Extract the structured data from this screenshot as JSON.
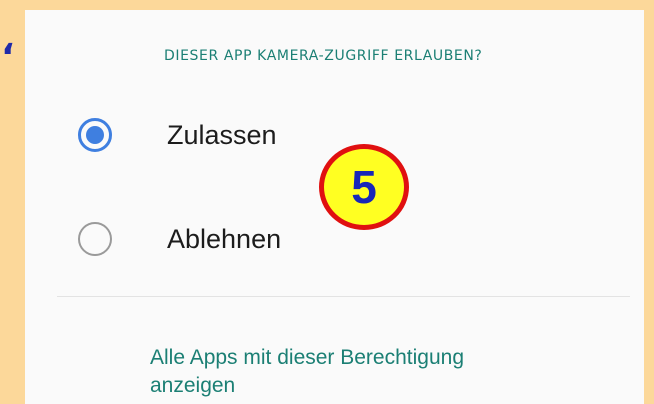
{
  "side_mark": "‘",
  "permission": {
    "question": "DIESER APP KAMERA-ZUGRIFF ERLAUBEN?",
    "options": [
      {
        "label": "Zulassen",
        "selected": true
      },
      {
        "label": "Ablehnen",
        "selected": false
      }
    ],
    "all_apps_link": "Alle Apps mit dieser Berechtigung anzeigen"
  },
  "step_badge": "5",
  "colors": {
    "page_background": "#fcd89a",
    "panel_background": "#fafafa",
    "accent_teal": "#1b7f74",
    "radio_selected": "#3f7fe0",
    "radio_unselected": "#9a9a9a",
    "badge_fill": "#ffff22",
    "badge_border": "#e01010",
    "badge_text": "#1826b8"
  }
}
